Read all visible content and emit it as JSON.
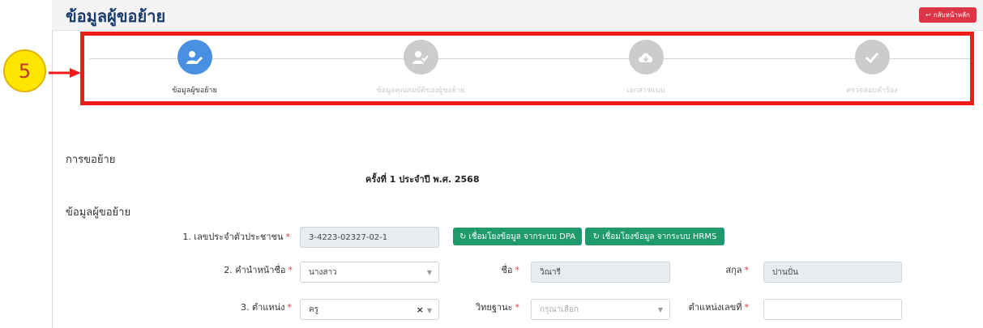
{
  "header": {
    "title": "ข้อมูลผู้ขอย้าย",
    "back_button": "กลับหน้าหลัก"
  },
  "annotation": {
    "step_number": "5"
  },
  "stepper": {
    "steps": [
      {
        "label": "ข้อมูลผู้ขอย้าย",
        "icon": "user-edit-icon",
        "active": true
      },
      {
        "label": "ข้อมูลคุณสมบัติของผู้ขอย้าย",
        "icon": "user-check-icon",
        "active": false
      },
      {
        "label": "เอกสารแนบ",
        "icon": "cloud-download-icon",
        "active": false
      },
      {
        "label": "ตรวจสอบคำร้อง",
        "icon": "check-icon",
        "active": false
      }
    ]
  },
  "transfer": {
    "section_title": "การขอย้าย",
    "round_text": "ครั้งที่ 1 ประจำปี พ.ศ. 2568"
  },
  "applicant": {
    "section_title": "ข้อมูลผู้ขอย้าย",
    "id_label": "1. เลขประจำตัวประชาชน",
    "id_value": "3-4223-02327-02-1",
    "dpa_button": "เชื่อมโยงข้อมูล จากระบบ DPA",
    "hrms_button": "เชื่อมโยงข้อมูล จากระบบ HRMS",
    "prefix_label": "2. คำนำหน้าชื่อ",
    "prefix_value": "นางสาว",
    "first_name_label": "ชื่อ",
    "first_name_value": "วิณารี",
    "last_name_label": "สกุล",
    "last_name_value": "ปานปั่น",
    "position_label": "3. ตำแหน่ง",
    "position_value": "ครู",
    "academic_label": "วิทยฐานะ",
    "academic_placeholder": "กรุณาเลือก",
    "position_no_label": "ตำแหน่งเลขที่",
    "position_no_value": ""
  },
  "colors": {
    "accent": "#4a90e2",
    "danger": "#dc3545",
    "success": "#1e9a6d",
    "highlight": "#ef1c1c",
    "badge": "#ffe600"
  }
}
